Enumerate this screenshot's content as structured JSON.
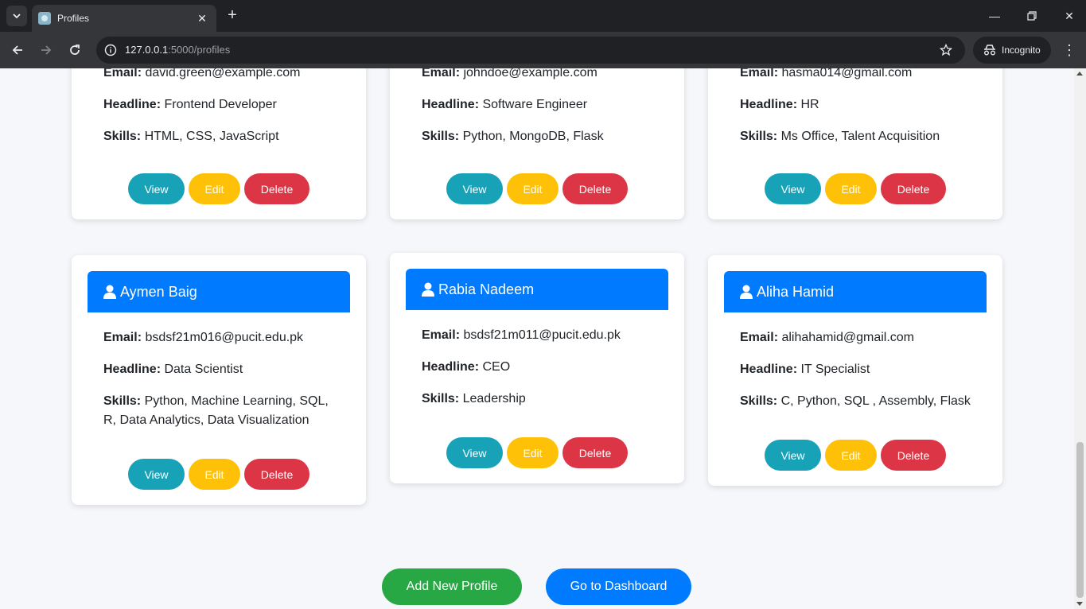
{
  "browser": {
    "tab_title": "Profiles",
    "url_host": "127.0.0.1",
    "url_rest": ":5000/profiles",
    "incognito_label": "Incognito"
  },
  "profiles_top": [
    {
      "email_label": "Email:",
      "email": "david.green@example.com",
      "headline_label": "Headline:",
      "headline": "Frontend Developer",
      "skills_label": "Skills:",
      "skills": "HTML, CSS, JavaScript"
    },
    {
      "email_label": "Email:",
      "email": "johndoe@example.com",
      "headline_label": "Headline:",
      "headline": "Software Engineer",
      "skills_label": "Skills:",
      "skills": "Python, MongoDB, Flask"
    },
    {
      "email_label": "Email:",
      "email": "hasma014@gmail.com",
      "headline_label": "Headline:",
      "headline": "HR",
      "skills_label": "Skills:",
      "skills": "Ms Office, Talent Acquisition"
    }
  ],
  "profiles_bottom": [
    {
      "name": "Aymen Baig",
      "email_label": "Email:",
      "email": "bsdsf21m016@pucit.edu.pk",
      "headline_label": "Headline:",
      "headline": "Data Scientist",
      "skills_label": "Skills:",
      "skills": "Python, Machine Learning, SQL, R, Data Analytics, Data Visualization"
    },
    {
      "name": "Rabia Nadeem",
      "email_label": "Email:",
      "email": "bsdsf21m011@pucit.edu.pk",
      "headline_label": "Headline:",
      "headline": "CEO",
      "skills_label": "Skills:",
      "skills": "Leadership"
    },
    {
      "name": "Aliha Hamid",
      "email_label": "Email:",
      "email": "alihahamid@gmail.com",
      "headline_label": "Headline:",
      "headline": "IT Specialist",
      "skills_label": "Skills:",
      "skills": "C, Python, SQL , Assembly, Flask"
    }
  ],
  "actions": {
    "view": "View",
    "edit": "Edit",
    "delete": "Delete"
  },
  "footer": {
    "add_profile": "Add New Profile",
    "dashboard": "Go to Dashboard"
  },
  "colors": {
    "primary": "#007bff",
    "info": "#17a2b8",
    "warning": "#ffc107",
    "danger": "#dc3545",
    "success": "#28a745"
  }
}
